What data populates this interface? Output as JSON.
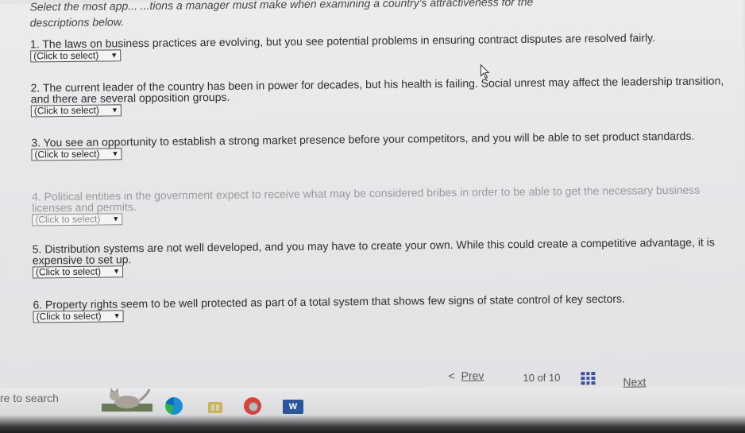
{
  "intro": {
    "line1": "Select the most app... ...tions a manager must make when examining a country's attractiveness for the",
    "line2": "descriptions below."
  },
  "questions": [
    {
      "text": "1. The laws on business practices are evolving, but you see potential problems in ensuring contract disputes are resolved fairly.",
      "select": "(Click to select)"
    },
    {
      "text": "2. The current leader of the country has been in power for decades, but his health is failing. Social unrest may affect the leadership transition, and there are several opposition groups.",
      "select": "(Click to select)"
    },
    {
      "text": "3. You see an opportunity to establish a strong market presence before your competitors, and you will be able to set product standards.",
      "select": "(Click to select)"
    },
    {
      "text": "4. Political entities in the government expect to receive what may be considered bribes in order to be able to get the necessary business licenses and permits.",
      "select": "(Click to select)"
    },
    {
      "text": "5. Distribution systems are not well developed, and you may have to create your own. While this could create a competitive advantage, it is expensive to set up.",
      "select": "(Click to select)"
    },
    {
      "text": "6. Property rights seem to be well protected as part of a total system that shows few signs of state control of key sectors.",
      "select": "(Click to select)"
    }
  ],
  "nav": {
    "prev_arrow": "<",
    "prev_label": "Prev",
    "page_current": "10",
    "page_of": "of",
    "page_total": "10",
    "next_label": "Next"
  },
  "taskbar": {
    "search_text": "re to search",
    "word_letter": "W",
    "icons": [
      "cat-widget-icon",
      "edge-icon",
      "file-explorer-icon",
      "chrome-icon",
      "word-icon"
    ]
  },
  "colors": {
    "accent": "#3a4fa0",
    "word": "#2b579a",
    "chrome": "#d8423a"
  }
}
